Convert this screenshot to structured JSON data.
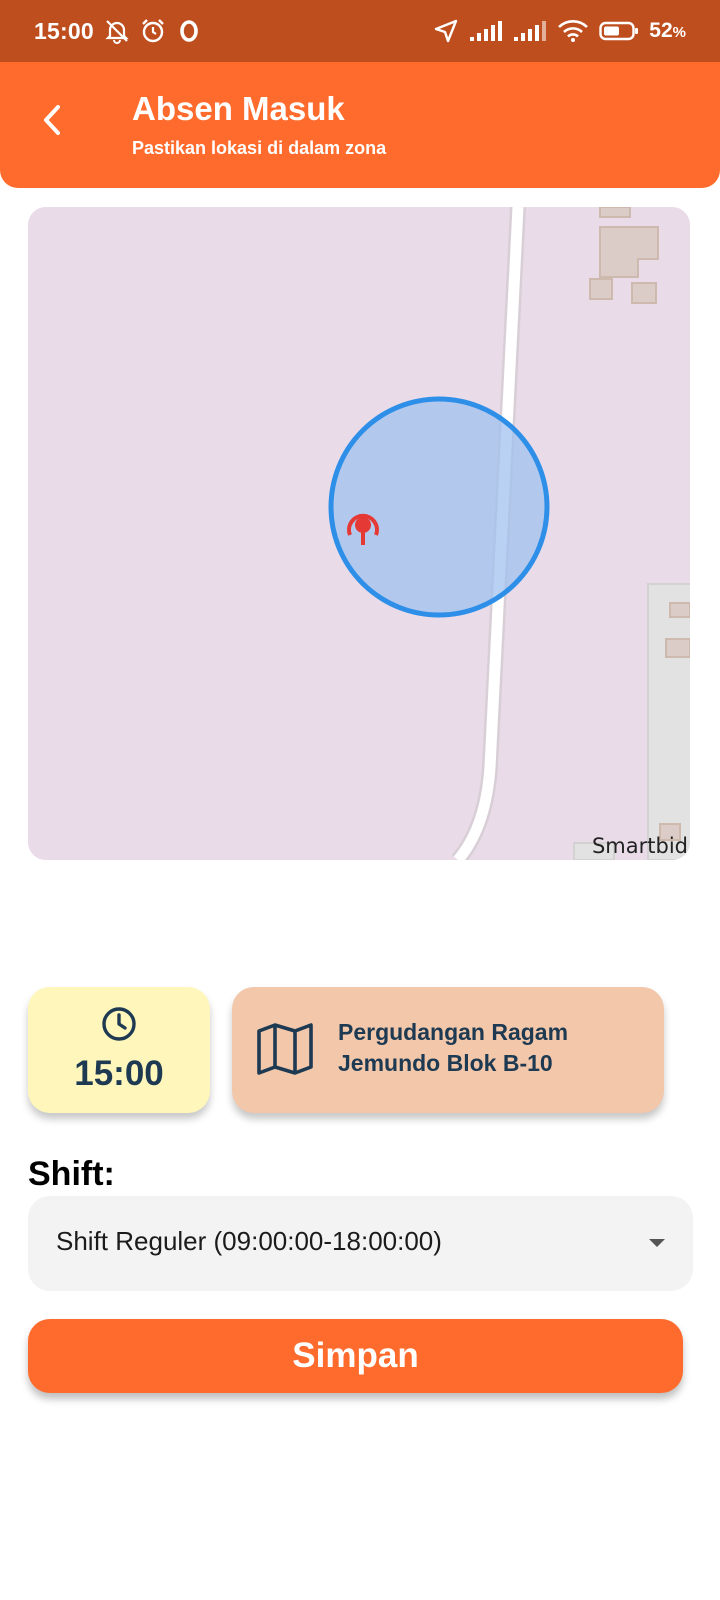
{
  "status_bar": {
    "time": "15:00",
    "battery_percent": "52",
    "battery_unit": "%",
    "icons": [
      "notifications-muted-icon",
      "alarm-icon",
      "app-o-icon",
      "location-arrow-icon",
      "signal-1-icon",
      "signal-2-icon",
      "wifi-icon",
      "battery-icon"
    ]
  },
  "header": {
    "title": "Absen Masuk",
    "subtitle": "Pastikan lokasi di dalam zona",
    "back_icon": "chevron-left-icon"
  },
  "map": {
    "attribution": "Smartbid"
  },
  "time_card": {
    "icon": "clock-icon",
    "value": "15:00"
  },
  "location_card": {
    "icon": "map-icon",
    "address": "Pergudangan Ragam Jemundo Blok B-10"
  },
  "shift": {
    "label": "Shift:",
    "selected": "Shift Reguler (09:00:00-18:00:00)",
    "dropdown_icon": "caret-down-icon"
  },
  "actions": {
    "save_label": "Simpan"
  },
  "colors": {
    "status_bar": "#bf4e1f",
    "accent": "#ff6b2c",
    "text_dark": "#1e3a52",
    "time_card_bg": "#fef6bb",
    "location_card_bg": "#f2c7aa",
    "zone_circle": "#2e8fe8",
    "marker": "#e53935"
  }
}
